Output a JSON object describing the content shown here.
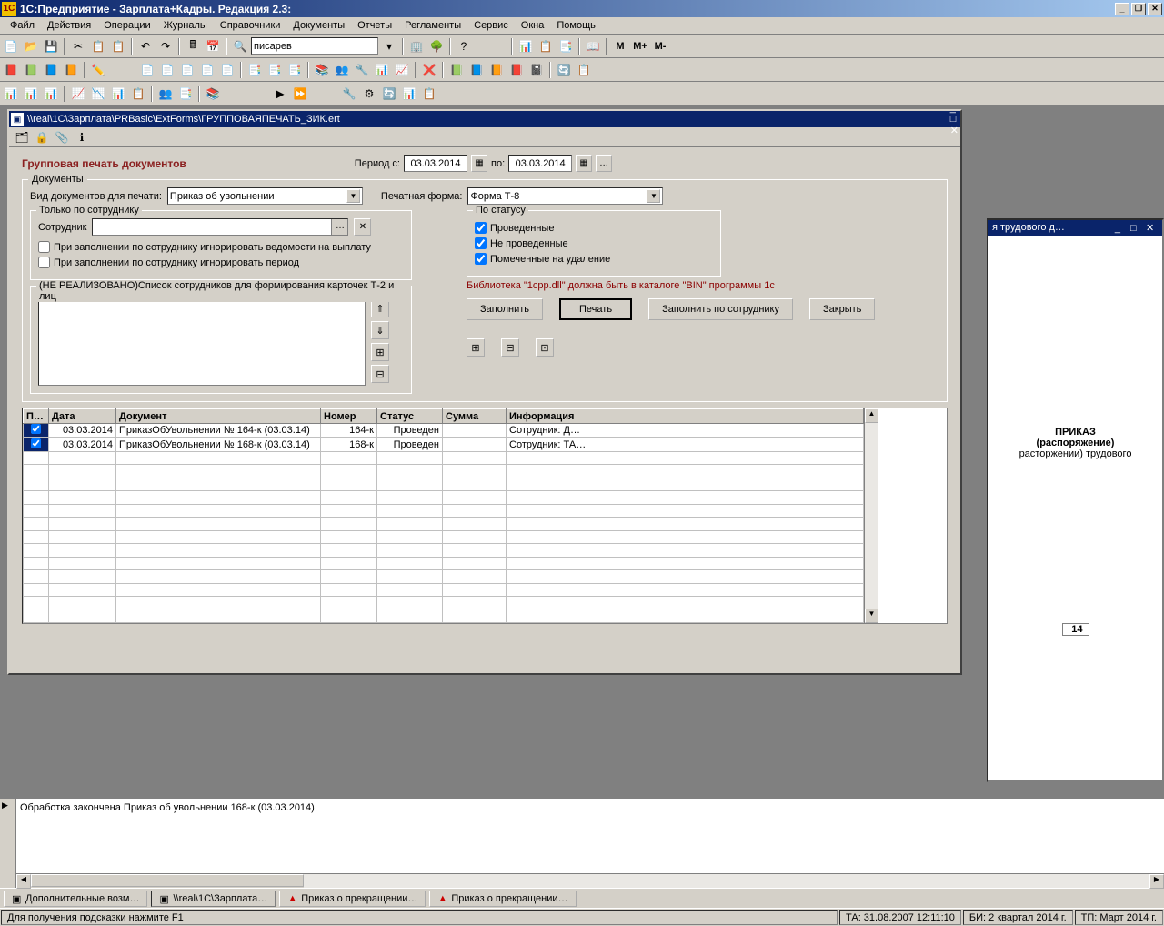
{
  "app": {
    "title": "1С:Предприятие - Зарплата+Кадры. Редакция 2.3:"
  },
  "menu": [
    "Файл",
    "Действия",
    "Операции",
    "Журналы",
    "Справочники",
    "Документы",
    "Отчеты",
    "Регламенты",
    "Сервис",
    "Окна",
    "Помощь"
  ],
  "toolbar2_text": [
    "M",
    "M+",
    "M-"
  ],
  "combobox_value": "писарев",
  "inner": {
    "title": "\\\\real\\1С\\Зарплата\\PRBasic\\ExtForms\\ГРУППОВАЯПЕЧАТЬ_ЗИК.ert",
    "form_title": "Групповая печать документов",
    "period_from_label": "Период с:",
    "period_to_label": "по:",
    "date_from": "03.03.2014",
    "date_to": "03.03.2014",
    "docs_legend": "Документы",
    "doc_type_label": "Вид документов для печати:",
    "doc_type_value": "Приказ об увольнении",
    "print_form_label": "Печатная форма:",
    "print_form_value": "Форма Т-8",
    "by_emp_legend": "Только по сотруднику",
    "emp_label": "Сотрудник",
    "chk_ignore_ved": "При заполнении по сотруднику игнорировать ведомости на выплату",
    "chk_ignore_period": "При заполнении по сотруднику игнорировать период",
    "list_legend": "(НЕ РЕАЛИЗОВАНО)Список сотрудников для формирования карточек Т-2 и лиц",
    "by_status_legend": "По статусу",
    "chk_posted": "Проведенные",
    "chk_unposted": "Не проведенные",
    "chk_deleted": "Помеченные на удаление",
    "warn": "Библиотека \"1cpp.dll\" должна быть в каталоге \"BIN\" программы 1с",
    "btn_fill": "Заполнить",
    "btn_print": "Печать",
    "btn_fill_emp": "Заполнить по сотруднику",
    "btn_close": "Закрыть"
  },
  "grid": {
    "headers": [
      "П…",
      "Дата",
      "Документ",
      "Номер",
      "Статус",
      "Сумма",
      "Информация"
    ],
    "rows": [
      {
        "chk": true,
        "date": "03.03.2014",
        "doc": "ПриказОбУвольнении № 164-к (03.03.14)",
        "num": "164-к",
        "status": "Проведен",
        "sum": "",
        "info": "Сотрудник: Д…"
      },
      {
        "chk": true,
        "date": "03.03.2014",
        "doc": "ПриказОбУвольнении № 168-к (03.03.14)",
        "num": "168-к",
        "status": "Проведен",
        "sum": "",
        "info": "Сотрудник: ТА…"
      }
    ]
  },
  "right": {
    "title": "я трудового д…",
    "h1": "ПРИКАЗ",
    "h2": "(распоряжение)",
    "h3": "расторжении) трудового",
    "badge": "14"
  },
  "log": {
    "msg": "Обработка закончена Приказ об увольнении 168-к (03.03.2014)"
  },
  "tasks": [
    "Дополнительные возм…",
    "\\\\real\\1С\\Зарплата…",
    "Приказ о прекращении…",
    "Приказ о прекращении…"
  ],
  "status": {
    "hint": "Для получения подсказки нажмите F1",
    "ta": "ТА: 31.08.2007  12:11:10",
    "bi": "БИ: 2 квартал 2014 г.",
    "tp": "ТП: Март 2014 г."
  }
}
